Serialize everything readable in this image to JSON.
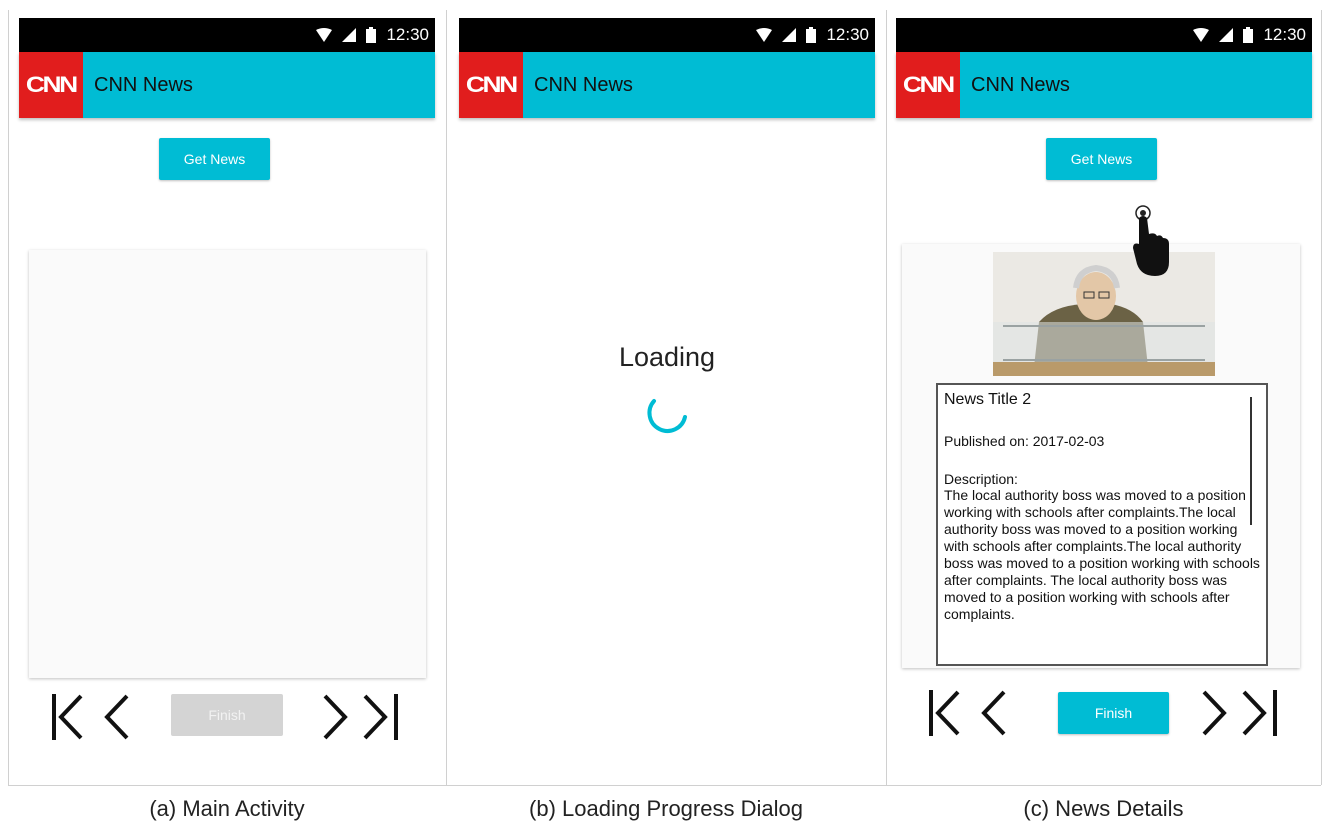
{
  "status_bar": {
    "time": "12:30"
  },
  "app_bar": {
    "logo_text": "CNN",
    "title": "CNN News"
  },
  "main_activity": {
    "get_news_label": "Get News",
    "finish_label": "Finish",
    "finish_enabled": false,
    "caption": "(a) Main Activity"
  },
  "loading_dialog": {
    "message": "Loading",
    "caption": "(b) Loading Progress Dialog"
  },
  "news_details": {
    "get_news_label": "Get News",
    "finish_label": "Finish",
    "finish_enabled": true,
    "news_title": "News Title 2",
    "published": "Published on: 2017-02-03",
    "description_label": "Description:",
    "description": "The local authority boss was moved to a position working with schools after complaints.The local authority boss was moved to a position working with schools after complaints.The local authority boss was moved to a position working with schools after complaints. The local authority boss was moved to a position working with schools after complaints.",
    "caption": "(c) News Details"
  },
  "icons": {
    "first": "skip-to-first-icon",
    "prev": "previous-icon",
    "next": "next-icon",
    "last": "skip-to-last-icon",
    "touch": "hand-pointer-icon",
    "spinner": "loading-spinner-icon"
  },
  "colors": {
    "accent": "#00bcd4",
    "logo_red": "#e11d1d",
    "status_bar": "#000000",
    "disabled_button": "#d4d4d4"
  }
}
